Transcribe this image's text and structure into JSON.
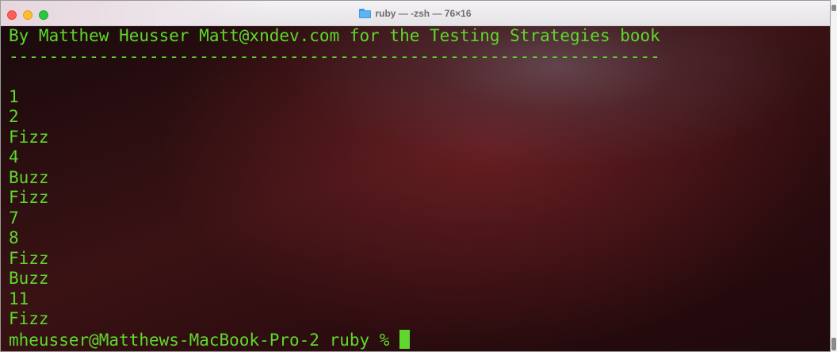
{
  "window": {
    "title": "ruby — -zsh — 76×16",
    "icon": "folder-icon"
  },
  "terminal": {
    "lines": [
      "By Matthew Heusser Matt@xndev.com for the Testing Strategies book",
      "-----------------------------------------------------------------",
      "",
      "1",
      "2",
      "Fizz",
      "4",
      "Buzz",
      "Fizz",
      "7",
      "8",
      "Fizz",
      "Buzz",
      "11",
      "Fizz"
    ],
    "prompt": "mheusser@Matthews-MacBook-Pro-2 ruby % ",
    "text_color": "#5fd82d",
    "background_color": "#2a0d0f"
  }
}
